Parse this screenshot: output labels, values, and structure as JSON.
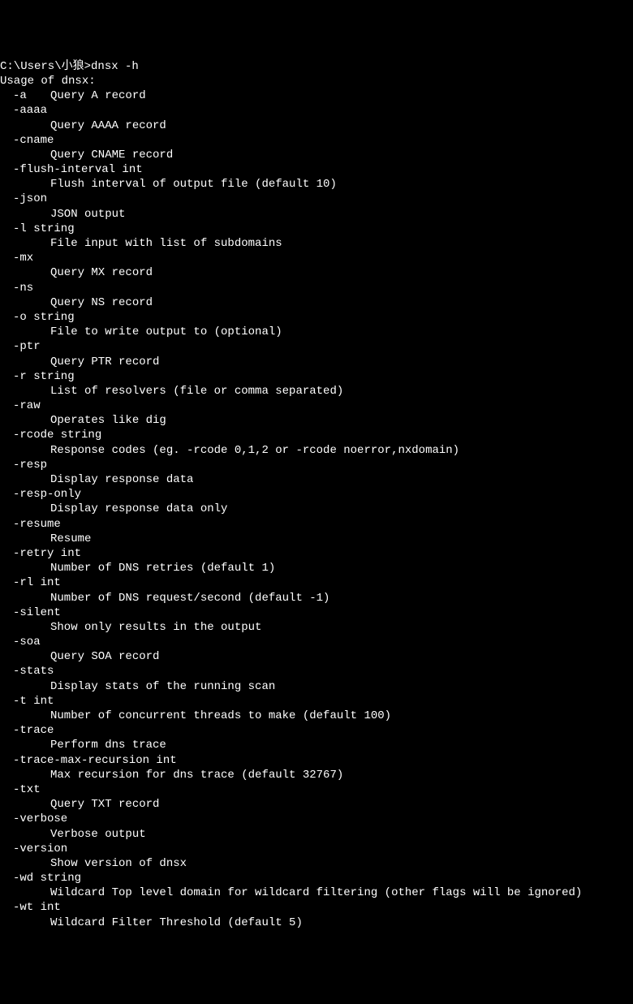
{
  "prompt": "C:\\Users\\小狼>",
  "command": "dnsx -h",
  "usage_line": "Usage of dnsx:",
  "flags": [
    {
      "flag": "-a",
      "desc": "Query A record",
      "inline": true
    },
    {
      "flag": "-aaaa",
      "desc": "Query AAAA record",
      "inline": false
    },
    {
      "flag": "-cname",
      "desc": "Query CNAME record",
      "inline": false
    },
    {
      "flag": "-flush-interval int",
      "desc": "Flush interval of output file (default 10)",
      "inline": false
    },
    {
      "flag": "-json",
      "desc": "JSON output",
      "inline": false
    },
    {
      "flag": "-l string",
      "desc": "File input with list of subdomains",
      "inline": false
    },
    {
      "flag": "-mx",
      "desc": "Query MX record",
      "inline": false
    },
    {
      "flag": "-ns",
      "desc": "Query NS record",
      "inline": false
    },
    {
      "flag": "-o string",
      "desc": "File to write output to (optional)",
      "inline": false
    },
    {
      "flag": "-ptr",
      "desc": "Query PTR record",
      "inline": false
    },
    {
      "flag": "-r string",
      "desc": "List of resolvers (file or comma separated)",
      "inline": false
    },
    {
      "flag": "-raw",
      "desc": "Operates like dig",
      "inline": false
    },
    {
      "flag": "-rcode string",
      "desc": "Response codes (eg. -rcode 0,1,2 or -rcode noerror,nxdomain)",
      "inline": false
    },
    {
      "flag": "-resp",
      "desc": "Display response data",
      "inline": false
    },
    {
      "flag": "-resp-only",
      "desc": "Display response data only",
      "inline": false
    },
    {
      "flag": "-resume",
      "desc": "Resume",
      "inline": false
    },
    {
      "flag": "-retry int",
      "desc": "Number of DNS retries (default 1)",
      "inline": false
    },
    {
      "flag": "-rl int",
      "desc": "Number of DNS request/second (default -1)",
      "inline": false
    },
    {
      "flag": "-silent",
      "desc": "Show only results in the output",
      "inline": false
    },
    {
      "flag": "-soa",
      "desc": "Query SOA record",
      "inline": false
    },
    {
      "flag": "-stats",
      "desc": "Display stats of the running scan",
      "inline": false
    },
    {
      "flag": "-t int",
      "desc": "Number of concurrent threads to make (default 100)",
      "inline": false
    },
    {
      "flag": "-trace",
      "desc": "Perform dns trace",
      "inline": false
    },
    {
      "flag": "-trace-max-recursion int",
      "desc": "Max recursion for dns trace (default 32767)",
      "inline": false
    },
    {
      "flag": "-txt",
      "desc": "Query TXT record",
      "inline": false
    },
    {
      "flag": "-verbose",
      "desc": "Verbose output",
      "inline": false
    },
    {
      "flag": "-version",
      "desc": "Show version of dnsx",
      "inline": false
    },
    {
      "flag": "-wd string",
      "desc": "Wildcard Top level domain for wildcard filtering (other flags will be ignored)",
      "inline": false
    },
    {
      "flag": "-wt int",
      "desc": "Wildcard Filter Threshold (default 5)",
      "inline": false
    }
  ]
}
